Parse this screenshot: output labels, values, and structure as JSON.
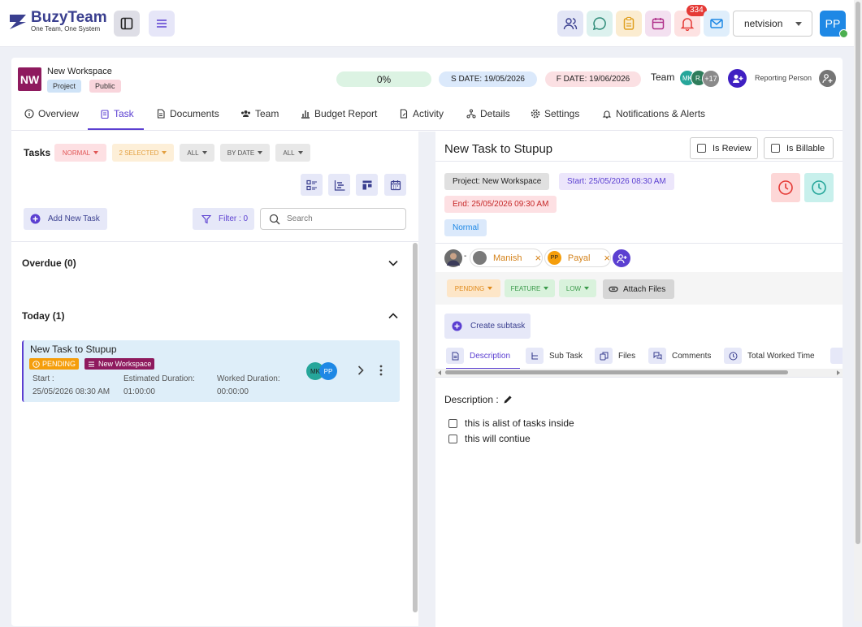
{
  "app": {
    "brand": "BuzyTeam",
    "tagline": "One Team, One System",
    "notification_count": "334",
    "org_select": "netvision",
    "user_initials": "PP"
  },
  "workspace": {
    "name": "New Workspace",
    "chips": [
      "Project",
      "Public"
    ],
    "progress": "0%",
    "start_date": "S DATE: 19/05/2026",
    "finish_date": "F DATE: 19/06/2026",
    "team_label": "Team",
    "team_avatars": [
      "MK",
      "R.",
      "+17"
    ],
    "reporting_label": "Reporting Person"
  },
  "tabs": [
    "Overview",
    "Task",
    "Documents",
    "Team",
    "Budget Report",
    "Activity",
    "Details",
    "Settings",
    "Notifications & Alerts"
  ],
  "tasks": {
    "title": "Tasks",
    "filters": [
      "NORMAL",
      "2 SELECTED",
      "ALL",
      "BY DATE",
      "ALL"
    ],
    "add_label": "Add New Task",
    "filter_label": "Filter : 0",
    "search_placeholder": "Search",
    "overdue": "Overdue (0)",
    "today": "Today (1)",
    "card": {
      "title": "New Task to Stupup",
      "status": "PENDING",
      "workspace": "New Workspace",
      "start_label": "Start :",
      "start_value": "25/05/2026 08:30 AM",
      "est_label": "Estimated Duration:",
      "est_value": "01:00:00",
      "worked_label": "Worked Duration:",
      "worked_value": "00:00:00",
      "avatars": [
        "MK",
        "PP"
      ]
    }
  },
  "detail": {
    "title": "New Task to Stupup",
    "is_review": "Is Review",
    "is_billable": "Is Billable",
    "project": "Project: New Workspace",
    "start": "Start: 25/05/2026 08:30 AM",
    "end": "End: 25/05/2026 09:30 AM",
    "priority": "Normal",
    "assignees": [
      {
        "initials": "",
        "name": "Manish"
      },
      {
        "initials": "PP",
        "name": "Payal"
      }
    ],
    "status_chips": [
      "PENDING",
      "FEATURE",
      "LOW"
    ],
    "attach_label": "Attach Files",
    "subtask_label": "Create subtask",
    "subtabs": [
      "Description",
      "Sub Task",
      "Files",
      "Comments",
      "Total Worked Time"
    ],
    "description_label": "Description :",
    "checklist": [
      "this is alist of tasks inside",
      "this will contiue"
    ]
  }
}
